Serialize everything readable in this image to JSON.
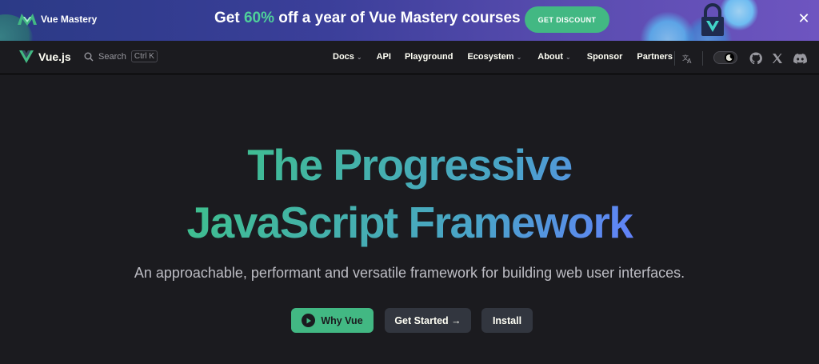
{
  "banner": {
    "logo_text": "Vue Mastery",
    "promo_prefix": "Get ",
    "promo_percent": "60%",
    "promo_suffix": " off a year of Vue Mastery courses",
    "cta_label": "GET DISCOUNT",
    "close_symbol": "✕",
    "colors": {
      "accent": "#42b883"
    }
  },
  "navbar": {
    "brand": "Vue.js",
    "search": {
      "label": "Search",
      "shortcut": "Ctrl K"
    },
    "links": [
      {
        "label": "Docs",
        "dropdown": true
      },
      {
        "label": "API",
        "dropdown": false
      },
      {
        "label": "Playground",
        "dropdown": false
      },
      {
        "label": "Ecosystem",
        "dropdown": true
      },
      {
        "label": "About",
        "dropdown": true
      },
      {
        "label": "Sponsor",
        "dropdown": false
      },
      {
        "label": "Partners",
        "dropdown": false
      }
    ],
    "icons": [
      "translate-icon",
      "theme-toggle",
      "github-icon",
      "x-icon",
      "discord-icon"
    ]
  },
  "hero": {
    "title_line1": "The Progressive",
    "title_line2": "JavaScript Framework",
    "subtitle": "An approachable, performant and versatile framework for building web user interfaces.",
    "buttons": {
      "why": "Why Vue",
      "started": "Get Started →",
      "install": "Install"
    }
  }
}
